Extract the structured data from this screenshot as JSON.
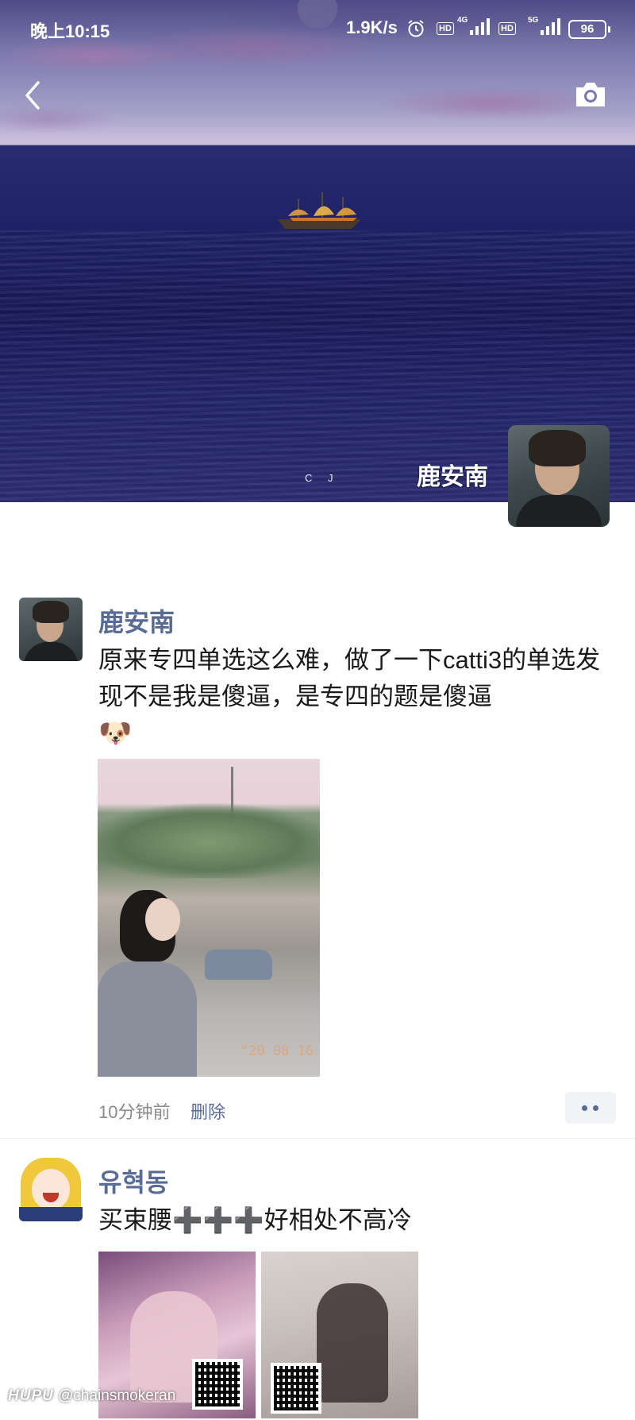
{
  "status_bar": {
    "time": "晚上10:15",
    "net_speed": "1.9K/s",
    "hd1": "HD",
    "gen1": "4G",
    "hd2": "HD",
    "gen2": "5G",
    "battery": "96"
  },
  "cover": {
    "user_name": "鹿安南",
    "watermark_letters": "C J",
    "icons": {
      "back": "back-arrow-icon",
      "camera": "camera-icon"
    }
  },
  "posts": [
    {
      "name": "鹿安南",
      "text": "原来专四单选这么难，做了一下catti3的单选发现不是我是傻逼，是专四的题是傻逼",
      "emoji": "🐶",
      "photo_stamp": "\"20 08 16",
      "time": "10分钟前",
      "delete_label": "删除"
    },
    {
      "name": "유혁동",
      "text": "买束腰➕➕➕好相处不高冷"
    }
  ],
  "watermark": {
    "logo": "HUPU",
    "handle": "@chainsmokeran"
  },
  "colors": {
    "link": "#586b95",
    "meta": "#8a8a8a",
    "more_bg": "#f2f3f6"
  }
}
